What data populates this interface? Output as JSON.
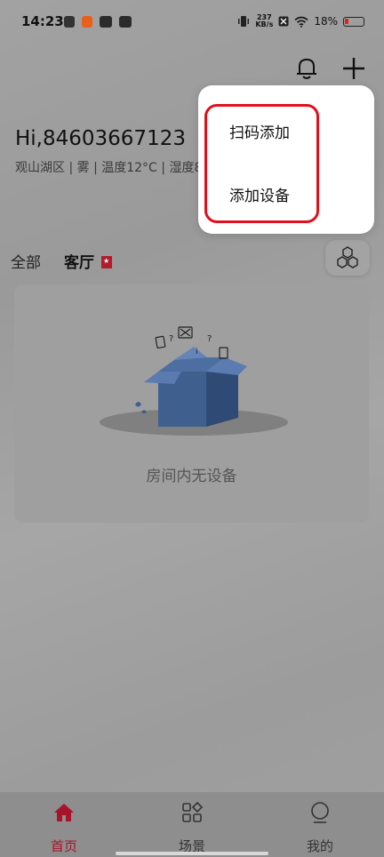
{
  "status_bar": {
    "time": "14:23",
    "speed_value": "237",
    "speed_unit": "KB/s",
    "battery_percent": "18%",
    "battery_level": 0.18
  },
  "header": {
    "greeting": "Hi,84603667123",
    "weather": "观山湖区 | 雾 | 温度12°C | 湿度8"
  },
  "popover": {
    "items": [
      {
        "label": "扫码添加"
      },
      {
        "label": "添加设备"
      }
    ]
  },
  "room_tabs": {
    "all": "全部",
    "current": "客厅"
  },
  "room_card": {
    "empty_text": "房间内无设备"
  },
  "bottom_nav": {
    "items": [
      {
        "label": "首页",
        "icon": "home-icon",
        "active": true
      },
      {
        "label": "场景",
        "icon": "scene-grid-icon",
        "active": false
      },
      {
        "label": "我的",
        "icon": "user-icon",
        "active": false
      }
    ]
  },
  "colors": {
    "accent": "#a5142a",
    "highlight_ring": "#e0101e"
  }
}
